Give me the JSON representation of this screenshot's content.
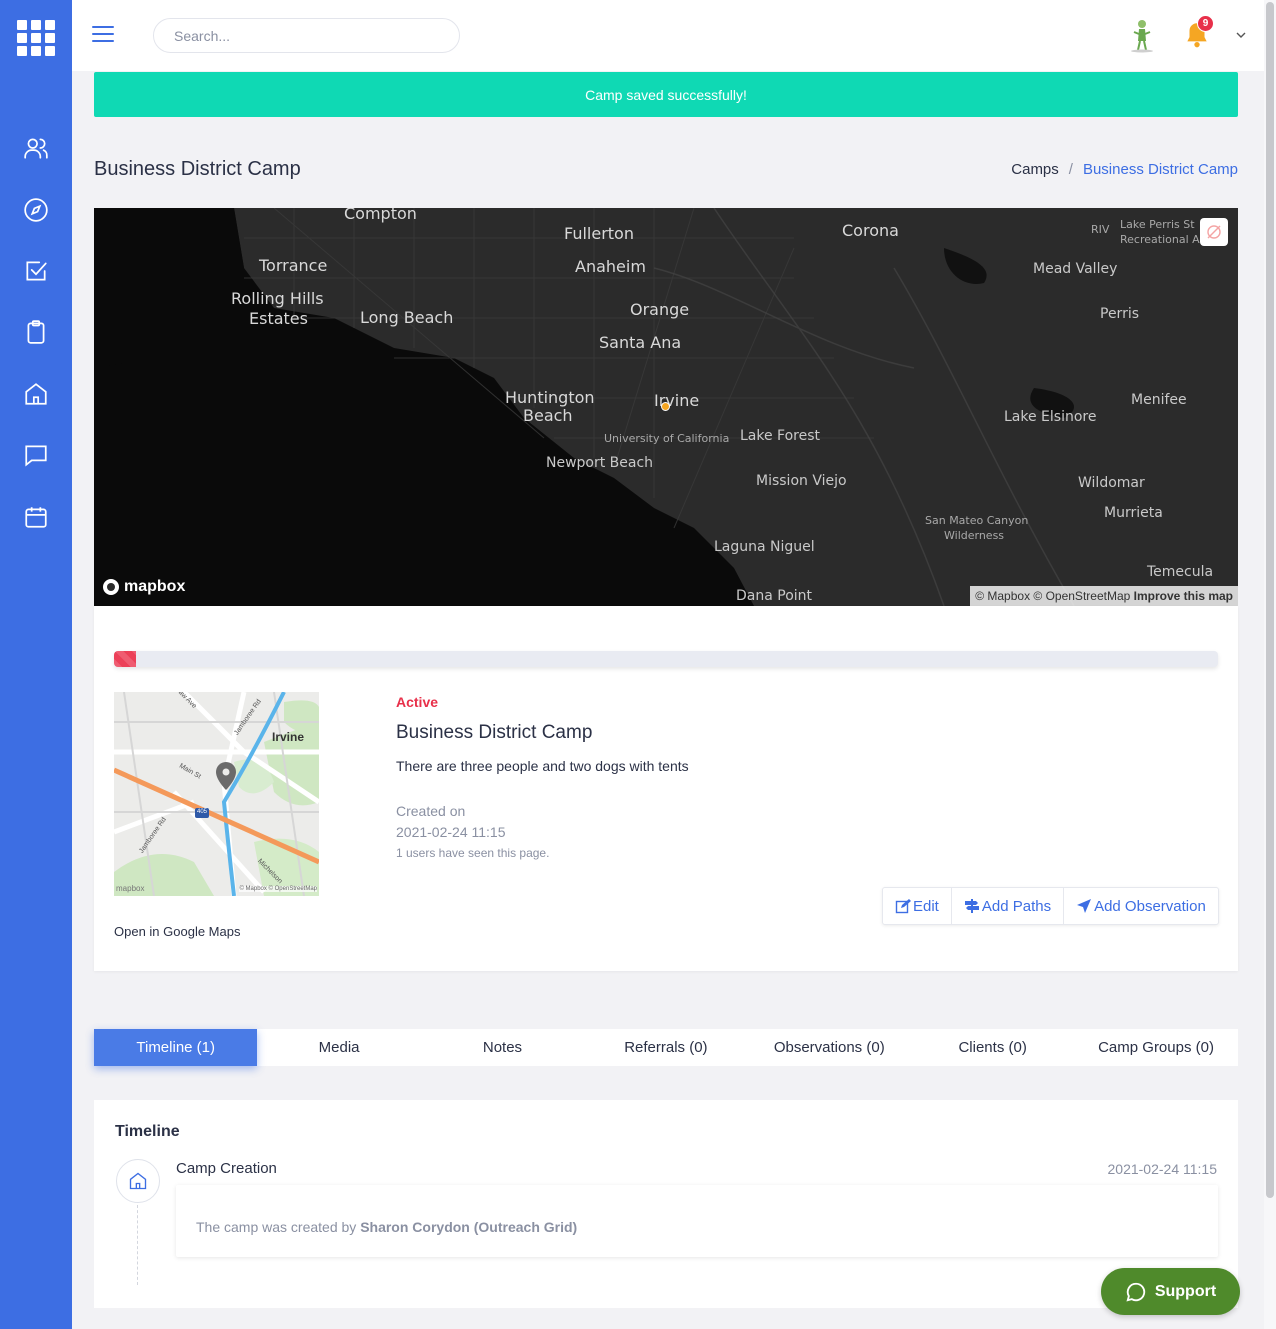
{
  "topbar": {
    "search_placeholder": "Search...",
    "notification_count": "9"
  },
  "alert": {
    "message": "Camp saved successfully!"
  },
  "header": {
    "title": "Business District Camp",
    "breadcrumb": {
      "parent": "Camps",
      "separator": "/",
      "current": "Business District Camp"
    }
  },
  "map": {
    "cities": {
      "compton": "Compton",
      "fullerton": "Fullerton",
      "corona": "Corona",
      "torrance": "Torrance",
      "anaheim": "Anaheim",
      "rolling_hills_1": "Rolling Hills",
      "rolling_hills_2": "Estates",
      "long_beach": "Long Beach",
      "orange": "Orange",
      "santa_ana": "Santa Ana",
      "mead_valley": "Mead Valley",
      "perris": "Perris",
      "huntington_1": "Huntington",
      "huntington_2": "Beach",
      "irvine": "Irvine",
      "university": "University of California",
      "lake_forest": "Lake Forest",
      "lake_elsinore": "Lake Elsinore",
      "menifee": "Menifee",
      "newport": "Newport Beach",
      "mission_viejo": "Mission Viejo",
      "wildomar": "Wildomar",
      "murrieta": "Murrieta",
      "san_mateo_1": "San Mateo Canyon",
      "san_mateo_2": "Wilderness",
      "laguna": "Laguna Niguel",
      "temecula": "Temecula",
      "dana_point": "Dana Point",
      "riv": "RIV",
      "lake_perris_1": "Lake Perris St",
      "lake_perris_2": "Recreational A"
    },
    "logo": "mapbox",
    "attribution": "© Mapbox © OpenStreetMap",
    "improve": "Improve this map"
  },
  "camp": {
    "progress_fraction": 0.02,
    "status": "Active",
    "name": "Business District Camp",
    "description": "There are three people and two dogs with tents",
    "created_label": "Created on",
    "created_date": "2021-02-24 11:15",
    "seen": "1 users have seen this page.",
    "gmaps_link": "Open in Google Maps",
    "minimap": {
      "irvine": "Irvine",
      "jamboree_1": "Jamboree Rd",
      "jamboree_2": "Jamboree Rd",
      "main_st": "Main St",
      "michelson": "Michelson",
      "ave": "aw Ave",
      "i405": "405",
      "logo": "mapbox",
      "attribution": "© Mapbox © OpenStreetMap"
    },
    "actions": {
      "edit": "Edit",
      "add_paths": "Add Paths",
      "add_observation": "Add Observation"
    }
  },
  "tabs": [
    {
      "label": "Timeline (1)",
      "active": true
    },
    {
      "label": "Media"
    },
    {
      "label": "Notes"
    },
    {
      "label": "Referrals (0)"
    },
    {
      "label": "Observations (0)"
    },
    {
      "label": "Clients (0)"
    },
    {
      "label": "Camp Groups (0)"
    }
  ],
  "timeline": {
    "title": "Timeline",
    "event": "Camp Creation",
    "date": "2021-02-24 11:15",
    "text_prefix": "The camp was created by",
    "author": "Sharon Corydon (Outreach Grid)"
  },
  "support": {
    "label": "Support"
  },
  "colors": {
    "primary": "#3d6ee3",
    "success": "#0fd9b4",
    "danger": "#e8304a",
    "support": "#4f8a2b"
  }
}
